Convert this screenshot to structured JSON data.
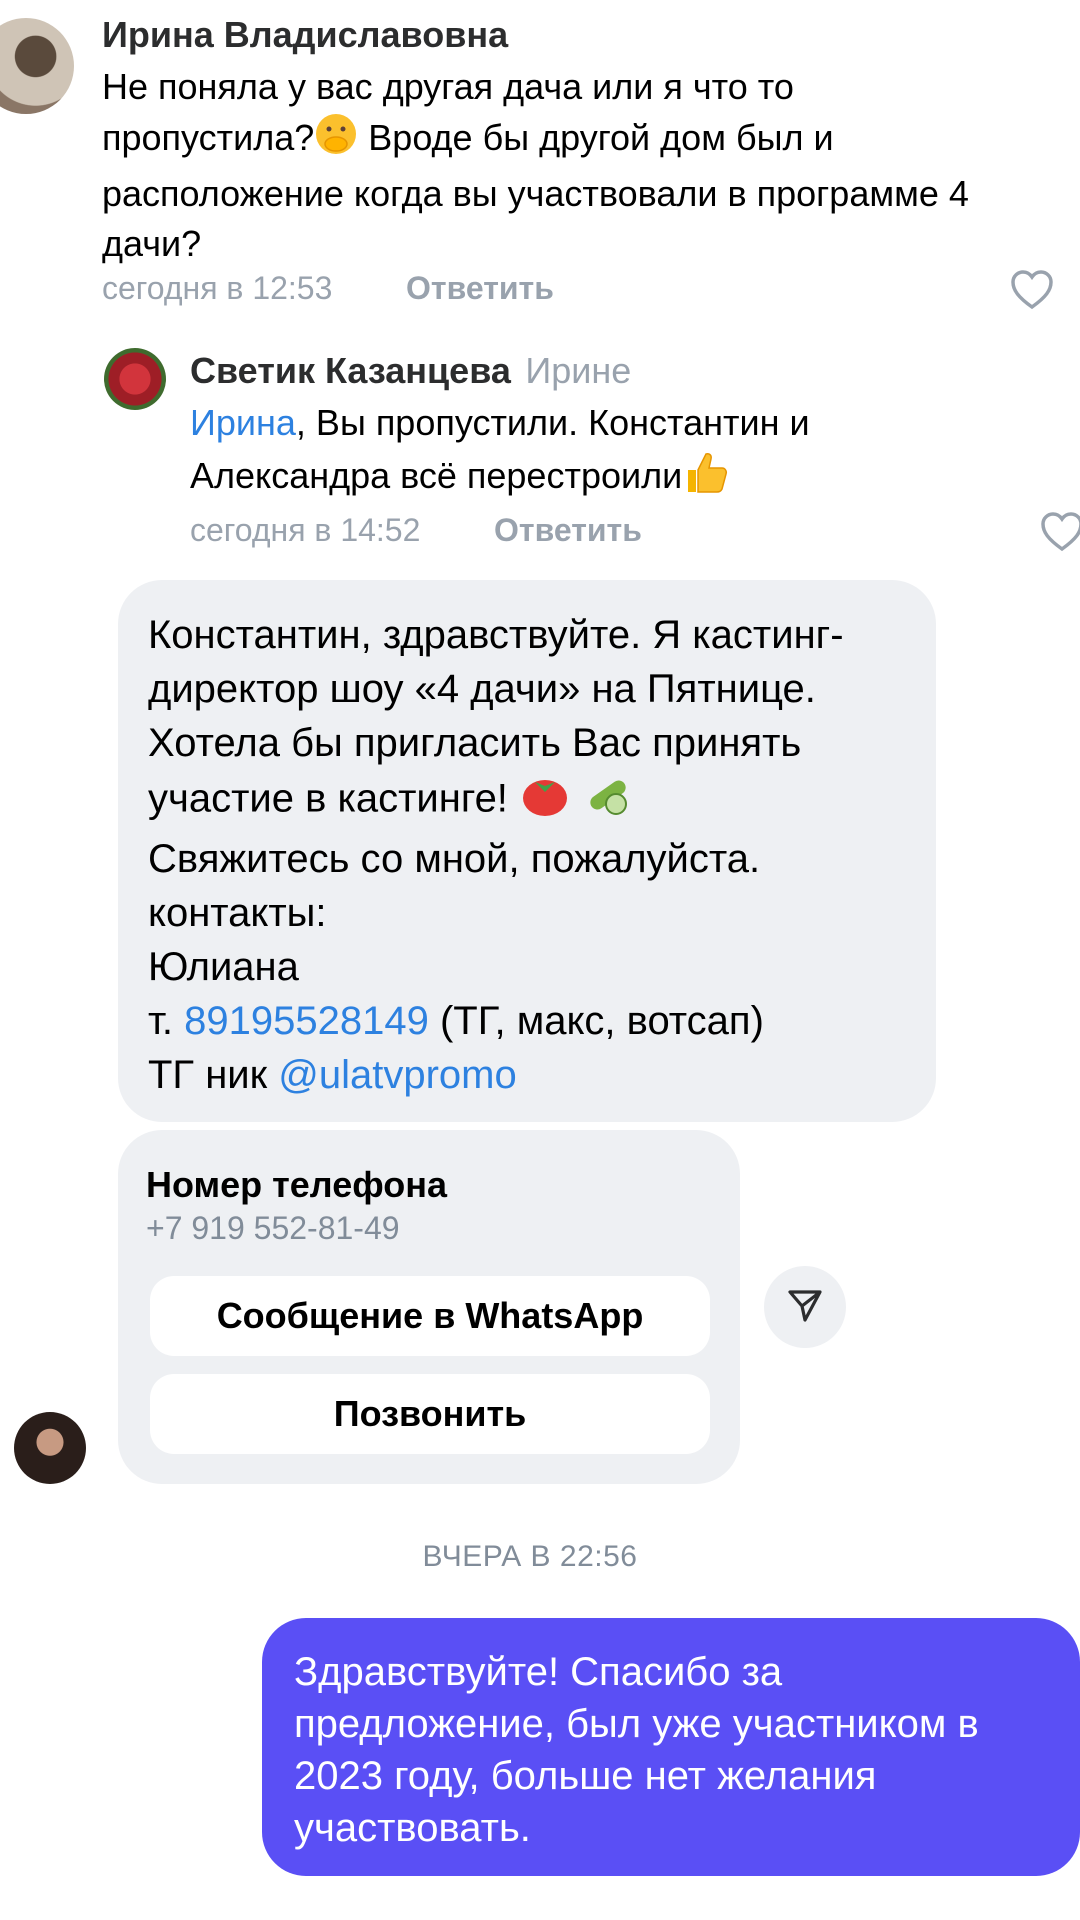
{
  "comment1": {
    "author": "Ирина Владиславовна",
    "text_lines": [
      "Не поняла у вас другая дача или я что то",
      "пропустила?",
      " Вроде бы другой дом был и",
      "расположение когда вы участвовали в программе 4",
      "дачи?"
    ],
    "time": "сегодня в 12:53",
    "reply_label": "Ответить"
  },
  "comment2": {
    "author": "Светик Казанцева",
    "reply_to": "Ирине",
    "mention": "Ирина",
    "text_line1_rest": ", Вы пропустили. Константин и",
    "text_line2": "Александра всё перестроили",
    "time": "сегодня в 14:52",
    "reply_label": "Ответить"
  },
  "message": {
    "lines": [
      "Константин, здравствуйте. Я кастинг-",
      "директор шоу «4 дачи» на Пятнице.",
      "Хотела бы пригласить Вас принять",
      "участие в кастинге!",
      "Свяжитесь со мной, пожалуйста.",
      "контакты:",
      "Юлиана"
    ],
    "phone_prefix": "т. ",
    "phone_link": "89195528149",
    "phone_suffix": " (ТГ, макс, вотсап)",
    "tg_prefix": "ТГ ник ",
    "tg_link": "@ulatvpromo"
  },
  "contact_card": {
    "title": "Номер телефона",
    "phone": "+7 919 552-81-49",
    "whatsapp_button": "Сообщение в WhatsApp",
    "call_button": "Позвонить"
  },
  "date_separator": "ВЧЕРА В 22:56",
  "outgoing": {
    "lines": [
      "Здравствуйте! Спасибо за",
      "предложение, был уже участником в",
      "2023 году, больше нет желания",
      "участвовать."
    ]
  },
  "colors": {
    "link": "#2d81e0",
    "outgoing_bubble": "#5a4ff5",
    "incoming_bubble": "#eef0f3"
  }
}
